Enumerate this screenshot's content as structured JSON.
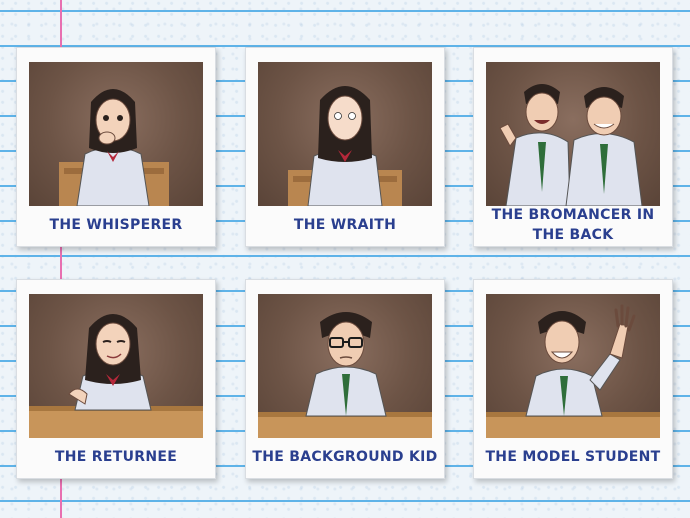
{
  "cards": [
    {
      "caption": "THE WHISPERER",
      "illustration-icon": "student-whispering-icon"
    },
    {
      "caption": "THE WRAITH",
      "illustration-icon": "student-pale-icon"
    },
    {
      "caption": "THE BROMANCER IN THE BACK",
      "illustration-icon": "two-students-icon"
    },
    {
      "caption": "THE RETURNEE",
      "illustration-icon": "student-smirking-icon"
    },
    {
      "caption": "THE BACKGROUND KID",
      "illustration-icon": "student-glasses-icon"
    },
    {
      "caption": "THE MODEL STUDENT",
      "illustration-icon": "student-hand-raised-icon"
    }
  ],
  "colors": {
    "caption_text": "#2a3f8f",
    "rule_lines": "#5fb3e8",
    "margin_line": "#e86fb0",
    "photo_background": "#6d5446",
    "desk": "#c8955a"
  }
}
